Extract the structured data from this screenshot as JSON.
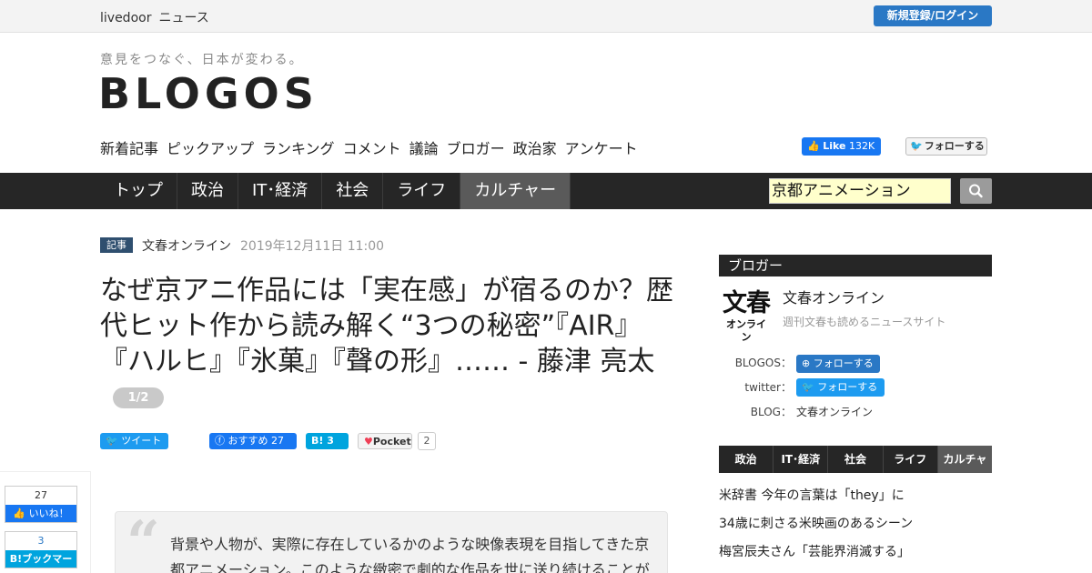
{
  "topbar": {
    "brand_1": "livedoor",
    "brand_2": "ニュース",
    "login": "新規登録/ログイン"
  },
  "header": {
    "tagline": "意見をつなぐ、日本が変わる。",
    "logo": "BLOGOS"
  },
  "subnav": [
    "新着記事",
    "ピックアップ",
    "ランキング",
    "コメント",
    "議論",
    "ブロガー",
    "政治家",
    "アンケート"
  ],
  "social": {
    "fb_like_label": "Like",
    "fb_like_count": "132K",
    "tw_follow": "フォローする"
  },
  "categories": [
    {
      "label": "トップ",
      "active": false
    },
    {
      "label": "政治",
      "active": false
    },
    {
      "label": "IT･経済",
      "active": false
    },
    {
      "label": "社会",
      "active": false
    },
    {
      "label": "ライフ",
      "active": false
    },
    {
      "label": "カルチャー",
      "active": true
    }
  ],
  "search": {
    "value": "京都アニメーション"
  },
  "article": {
    "tag": "記事",
    "source": "文春オンライン",
    "date": "2019年12月11日 11:00",
    "title": "なぜ京アニ作品には「実在感」が宿るのか？歴代ヒット作から読み解く“3つの秘密”『AIR』『ハルヒ』『氷菓』『聲の形』…… - 藤津 亮太",
    "page": "1/2",
    "quote": "背景や人物が、実際に存在しているかのような映像表現を目指してきた京都アニメーション。このような緻密で劇的な作品を世に送り続けることが"
  },
  "share": {
    "tweet": "ツイート",
    "fb": "おすすめ",
    "fb_count": "27",
    "hb_count": "3",
    "pocket": "Pocket",
    "pocket_count": "2"
  },
  "float_share": {
    "fb_count": "27",
    "fb_label": "いいね！",
    "hb_count": "3",
    "hb_label": "B!ブックマーク"
  },
  "sidebar": {
    "heading": "ブロガー",
    "logo_line1": "文春",
    "logo_line2": "オンライン",
    "author_name": "文春オンライン",
    "author_desc": "週刊文春も読めるニュースサイト",
    "blogos_label": "BLOGOS：",
    "blogos_btn": "フォローする",
    "twitter_label": "twitter：",
    "twitter_btn": "フォローする",
    "blog_label": "BLOG：",
    "blog_value": "文春オンライン",
    "tabs": [
      {
        "label": "政治",
        "active": false
      },
      {
        "label": "IT･経済",
        "active": false
      },
      {
        "label": "社会",
        "active": false
      },
      {
        "label": "ライフ",
        "active": false
      },
      {
        "label": "カルチャー",
        "active": true
      }
    ],
    "list": [
      "米辞書 今年の言葉は「they」に",
      "34歳に刺さる米映画のあるシーン",
      "梅宮辰夫さん「芸能界消滅する」"
    ]
  }
}
